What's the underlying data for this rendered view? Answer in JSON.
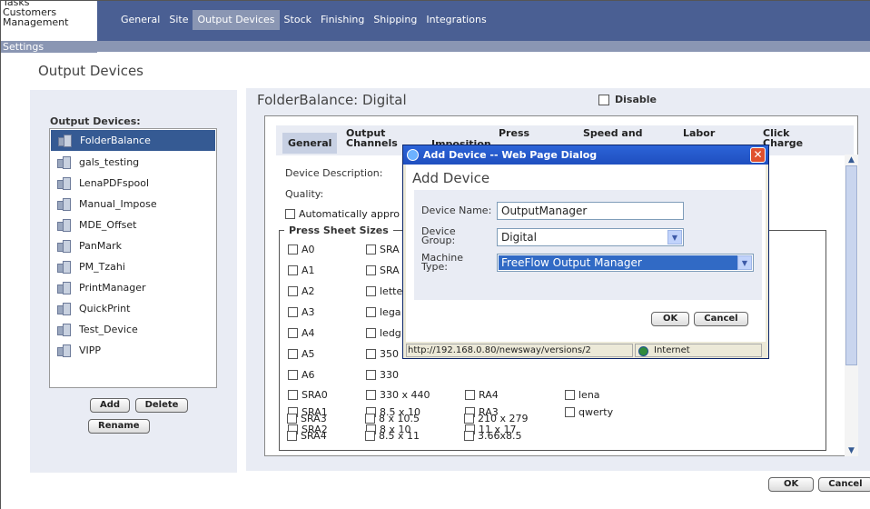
{
  "left_menu": {
    "tasks": "Tasks",
    "customers": "Customers",
    "management": "Management",
    "settings": "Settings"
  },
  "top_tabs": [
    {
      "label": "General",
      "active": false
    },
    {
      "label": "Site",
      "active": false
    },
    {
      "label": "Output Devices",
      "active": true
    },
    {
      "label": "Stock",
      "active": false
    },
    {
      "label": "Finishing",
      "active": false
    },
    {
      "label": "Shipping",
      "active": false
    },
    {
      "label": "Integrations",
      "active": false
    }
  ],
  "page_title": "Output Devices",
  "left_panel": {
    "label": "Output Devices:",
    "devices": [
      "FolderBalance",
      "gals_testing",
      "LenaPDFspool",
      "Manual_Impose",
      "MDE_Offset",
      "PanMark",
      "PM_Tzahi",
      "PrintManager",
      "QuickPrint",
      "Test_Device",
      "VIPP"
    ],
    "selected": "FolderBalance",
    "add_label": "Add",
    "delete_label": "Delete",
    "rename_label": "Rename"
  },
  "device_panel": {
    "title": "FolderBalance: Digital",
    "disable_label": "Disable",
    "tabs": {
      "general": "General",
      "output_1": "Output",
      "output_2": "Channels",
      "imposition": "Imposition",
      "press": "Press",
      "speed": "Speed and",
      "labor": "Labor",
      "click_1": "Click",
      "click_2": "Charge"
    },
    "device_description_label": "Device Description:",
    "quality_label": "Quality:",
    "auto_approve_label": "Automatically appro",
    "press_sheet_legend": "Press Sheet Sizes",
    "sizes_col1": [
      "A0",
      "A1",
      "A2",
      "A3",
      "A4",
      "A5",
      "A6",
      "SRA0",
      "SRA1",
      "SRA2",
      "SRA3",
      "SRA4"
    ],
    "sizes_col2": [
      "SRA",
      "SRA",
      "lette",
      "lega",
      "ledg",
      "350",
      "330",
      "330 x 440",
      "8.5 x 10",
      "8 x 10",
      "8 x 10.5",
      "8.5 x 11"
    ],
    "sizes_col3": [
      "RA4",
      "RA3",
      "11 x 17",
      "210 x 279",
      "3.66x8.5"
    ],
    "sizes_col4": [
      "lena",
      "qwerty"
    ]
  },
  "dialog": {
    "title": "Add Device -- Web Page Dialog",
    "close_symbol": "✕",
    "heading": "Add Device",
    "device_name_label": "Device Name:",
    "device_name_value": "OutputManager",
    "device_group_label_1": "Device",
    "device_group_label_2": "Group:",
    "device_group_value": "Digital",
    "machine_type_label_1": "Machine",
    "machine_type_label_2": "Type:",
    "machine_type_value": "FreeFlow Output Manager",
    "ok_label": "OK",
    "cancel_label": "Cancel",
    "status_url": "http://192.168.0.80/newsway/versions/2",
    "status_zone": "Internet"
  },
  "footer": {
    "ok_label": "OK",
    "cancel_label": "Cancel"
  }
}
